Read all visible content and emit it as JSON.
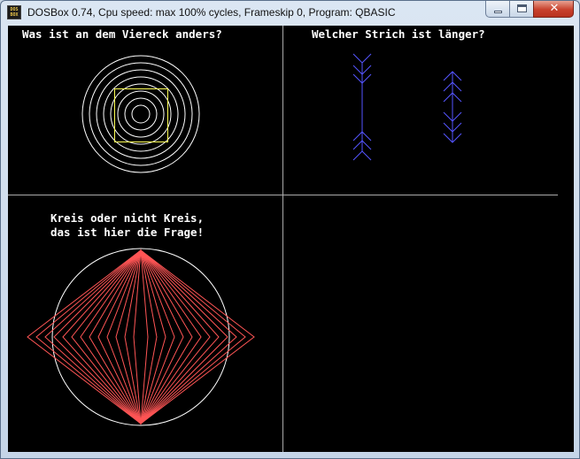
{
  "window": {
    "title": "DOSBox 0.74, Cpu speed: max 100% cycles, Frameskip  0, Program:   QBASIC",
    "icon_text": [
      "DOS",
      "BOX"
    ],
    "icon_name": "dosbox-icon",
    "buttons": {
      "minimize": "minimize-icon",
      "maximize": "maximize-icon",
      "close": "✕"
    }
  },
  "screen": {
    "top_left_caption": "Was ist an dem Viereck anders?",
    "top_right_caption": "Welcher Strich ist länger?",
    "bottom_left_caption": [
      "Kreis oder nicht Kreis,",
      "das ist hier die Frage!"
    ]
  },
  "colors": {
    "background": "#000000",
    "divider": "#aaaaaa",
    "circles": "#ffffff",
    "square": "#ffff55",
    "arrows": "#5555ff",
    "diamonds": "#ff5555"
  }
}
